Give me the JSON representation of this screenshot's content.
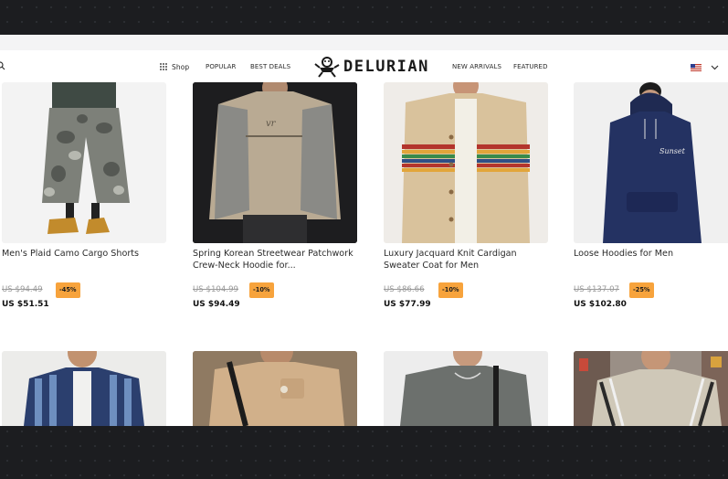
{
  "nav": {
    "shop": "Shop",
    "popular": "POPULAR",
    "best_deals": "BEST DEALS",
    "logo": "DELURIAN",
    "new_arrivals": "NEW ARRIVALS",
    "featured": "FEATURED"
  },
  "products": [
    {
      "title": "Men's Plaid Camo Cargo Shorts",
      "old_price": "US $94.49",
      "discount": "-45%",
      "price": "US $51.51"
    },
    {
      "title": "Spring Korean Streetwear Patchwork Crew-Neck Hoodie for...",
      "old_price": "US $104.99",
      "discount": "-10%",
      "price": "US $94.49"
    },
    {
      "title": "Luxury Jacquard Knit Cardigan Sweater Coat for Men",
      "old_price": "US $86.66",
      "discount": "-10%",
      "price": "US $77.99"
    },
    {
      "title": "Loose Hoodies for Men",
      "old_price": "US $137.07",
      "discount": "-25%",
      "price": "US $102.80"
    }
  ],
  "colors": {
    "badge": "#f7a33c",
    "background": "#1c1d20"
  }
}
